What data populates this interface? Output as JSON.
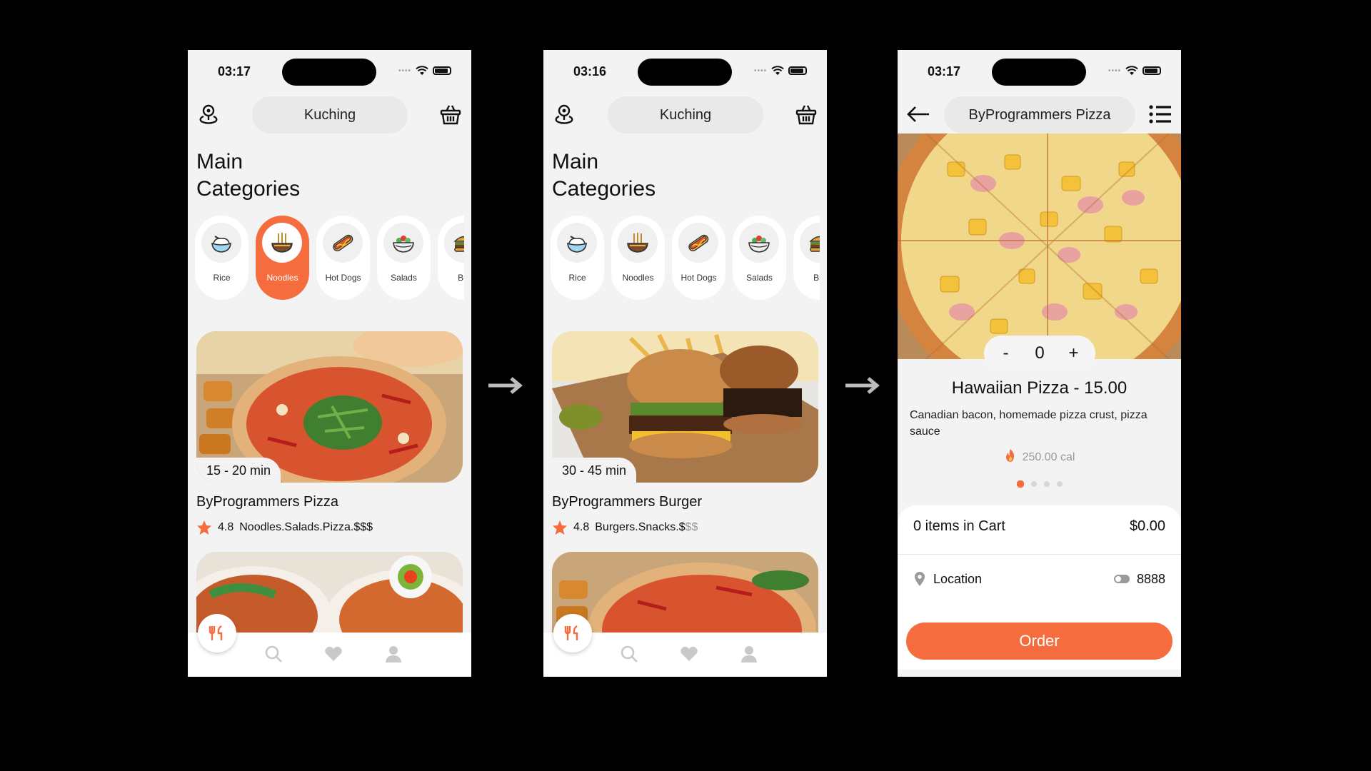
{
  "colors": {
    "accent": "#f56d3f",
    "background": "#000000",
    "screen": "#f3f3f3"
  },
  "phones": [
    {
      "status": {
        "time": "03:17"
      },
      "header": {
        "location": "Kuching"
      },
      "section_title": "Main\nCategories",
      "categories": [
        {
          "label": "Rice",
          "icon": "rice-bowl-icon",
          "active": false
        },
        {
          "label": "Noodles",
          "icon": "noodles-icon",
          "active": true
        },
        {
          "label": "Hot Dogs",
          "icon": "hotdog-icon",
          "active": false
        },
        {
          "label": "Salads",
          "icon": "salad-icon",
          "active": false
        },
        {
          "label": "Bur",
          "icon": "burger-icon",
          "active": false
        }
      ],
      "restaurant": {
        "eta": "15 - 20 min",
        "name": "ByProgrammers Pizza",
        "rating": "4.8",
        "tags": "Noodles.Salads.Pizza.",
        "price": "$$$",
        "price_dim": ""
      },
      "tabs": [
        "utensils-icon",
        "search-icon",
        "heart-icon",
        "user-icon"
      ]
    },
    {
      "status": {
        "time": "03:16"
      },
      "header": {
        "location": "Kuching"
      },
      "section_title": "Main\nCategories",
      "categories": [
        {
          "label": "Rice",
          "icon": "rice-bowl-icon",
          "active": false
        },
        {
          "label": "Noodles",
          "icon": "noodles-icon",
          "active": false
        },
        {
          "label": "Hot Dogs",
          "icon": "hotdog-icon",
          "active": false
        },
        {
          "label": "Salads",
          "icon": "salad-icon",
          "active": false
        },
        {
          "label": "Bur",
          "icon": "burger-icon",
          "active": false
        }
      ],
      "restaurant": {
        "eta": "30 - 45 min",
        "name": "ByProgrammers Burger",
        "rating": "4.8",
        "tags": "Burgers.Snacks.",
        "price": "$",
        "price_dim": "$$"
      },
      "tabs": [
        "utensils-icon",
        "search-icon",
        "heart-icon",
        "user-icon"
      ]
    }
  ],
  "detail": {
    "status": {
      "time": "03:17"
    },
    "header": {
      "title": "ByProgrammers Pizza"
    },
    "quantity": {
      "minus": "-",
      "value": "0",
      "plus": "+"
    },
    "item_name": "Hawaiian Pizza - 15.00",
    "item_desc": "Canadian bacon, homemade pizza crust, pizza sauce",
    "calories": "250.00 cal",
    "pager": {
      "count": 4,
      "active": 0
    },
    "cart": {
      "label": "0 items in Cart",
      "total": "$0.00"
    },
    "location": {
      "label": "Location",
      "value": "8888"
    },
    "order_label": "Order"
  }
}
